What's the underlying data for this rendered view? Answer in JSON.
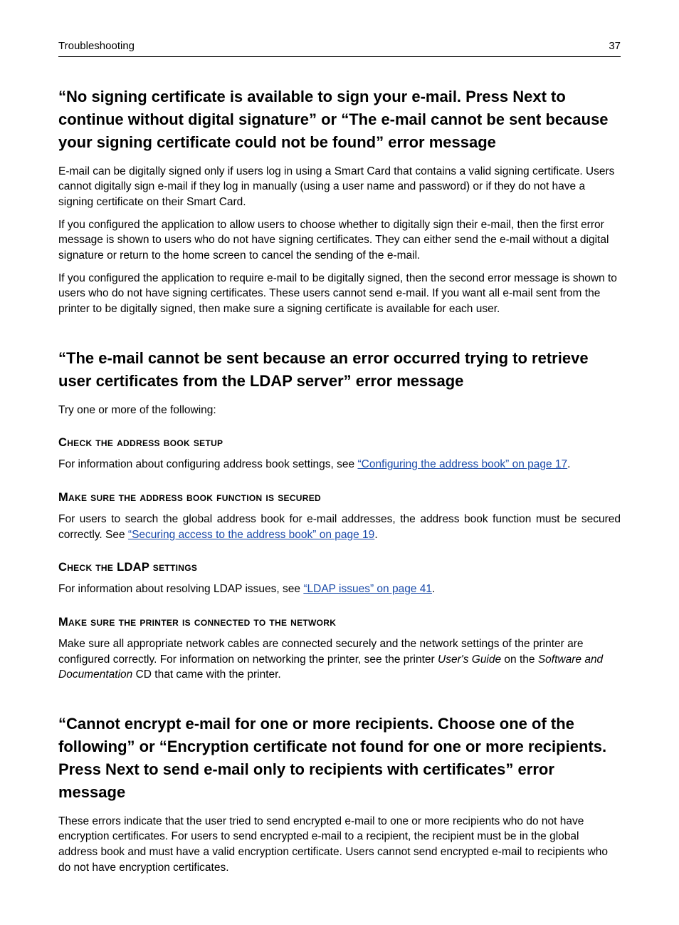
{
  "header": {
    "section": "Troubleshooting",
    "page_number": "37"
  },
  "sec1": {
    "heading": "“No signing certificate is available to sign your e‑mail. Press Next to continue without digital signature” or “The e‑mail cannot be sent because your signing certificate could not be found” error message",
    "p1": "E‑mail can be digitally signed only if users log in using a Smart Card that contains a valid signing certificate. Users cannot digitally sign e‑mail if they log in manually (using a user name and password) or if they do not have a signing certificate on their Smart Card.",
    "p2": "If you configured the application to allow users to choose whether to digitally sign their e‑mail, then the first error message is shown to users who do not have signing certificates. They can either send the e‑mail without a digital signature or return to the home screen to cancel the sending of the e‑mail.",
    "p3": "If you configured the application to require e‑mail to be digitally signed, then the second error message is shown to users who do not have signing certificates. These users cannot send e‑mail. If you want all e‑mail sent from the printer to be digitally signed, then make sure a signing certificate is available for each user."
  },
  "sec2": {
    "heading": "“The e‑mail cannot be sent because an error occurred trying to retrieve user certificates from the LDAP server” error message",
    "intro": "Try one or more of the following:",
    "sub1_heading": "Check the address book setup",
    "sub1_body_before": "For information about configuring address book settings, see ",
    "sub1_link": "“Configuring the address book” on page 17",
    "sub1_body_after": ".",
    "sub2_heading": "Make sure the address book function is secured",
    "sub2_body_before": "For users to search the global address book for e‑mail addresses, the address book function must be secured correctly. See ",
    "sub2_link": "“Securing access to the address book” on page 19",
    "sub2_body_after": ".",
    "sub3_heading": "Check the LDAP settings",
    "sub3_body_before": "For information about resolving LDAP issues, see ",
    "sub3_link": "“LDAP issues” on page 41",
    "sub3_body_after": ".",
    "sub4_heading": "Make sure the printer is connected to the network",
    "sub4_body_a": "Make sure all appropriate network cables are connected securely and the network settings of the printer are configured correctly. For information on networking the printer, see the printer ",
    "sub4_book1": "User's Guide",
    "sub4_body_b": " on the ",
    "sub4_book2": "Software and Documentation",
    "sub4_body_c": " CD that came with the printer."
  },
  "sec3": {
    "heading": "“Cannot encrypt e‑mail for one or more recipients. Choose one of the following” or “Encryption certificate not found for one or more recipients. Press Next to send e‑mail only to recipients with certificates” error message",
    "p1": "These errors indicate that the user tried to send encrypted e‑mail to one or more recipients who do not have encryption certificates. For users to send encrypted e‑mail to a recipient, the recipient must be in the global address book and must have a valid encryption certificate. Users cannot send encrypted e‑mail to recipients who do not have encryption certificates."
  }
}
